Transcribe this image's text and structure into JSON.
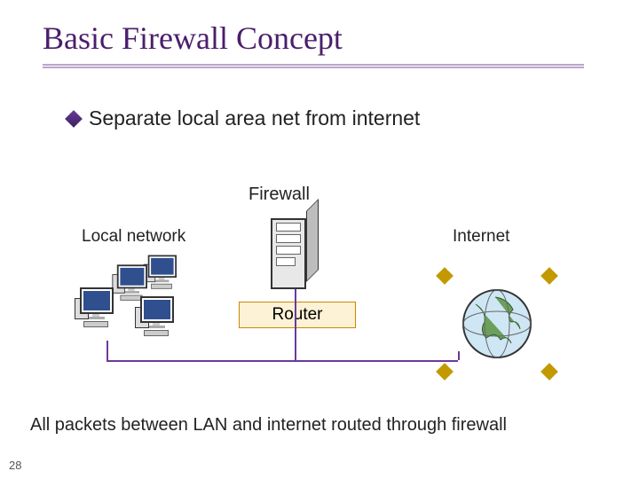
{
  "slide": {
    "number": "28",
    "title": "Basic Firewall Concept",
    "bullet": "Separate local area net from internet",
    "labels": {
      "firewall": "Firewall",
      "local_network": "Local network",
      "internet": "Internet",
      "router": "Router"
    },
    "footer": "All packets between LAN and internet routed through firewall",
    "icons": {
      "bullet": "diamond-icon",
      "server": "server-icon",
      "computer": "desktop-computer-icon",
      "globe": "globe-internet-icon",
      "satellite": "satellite-node-icon"
    }
  }
}
